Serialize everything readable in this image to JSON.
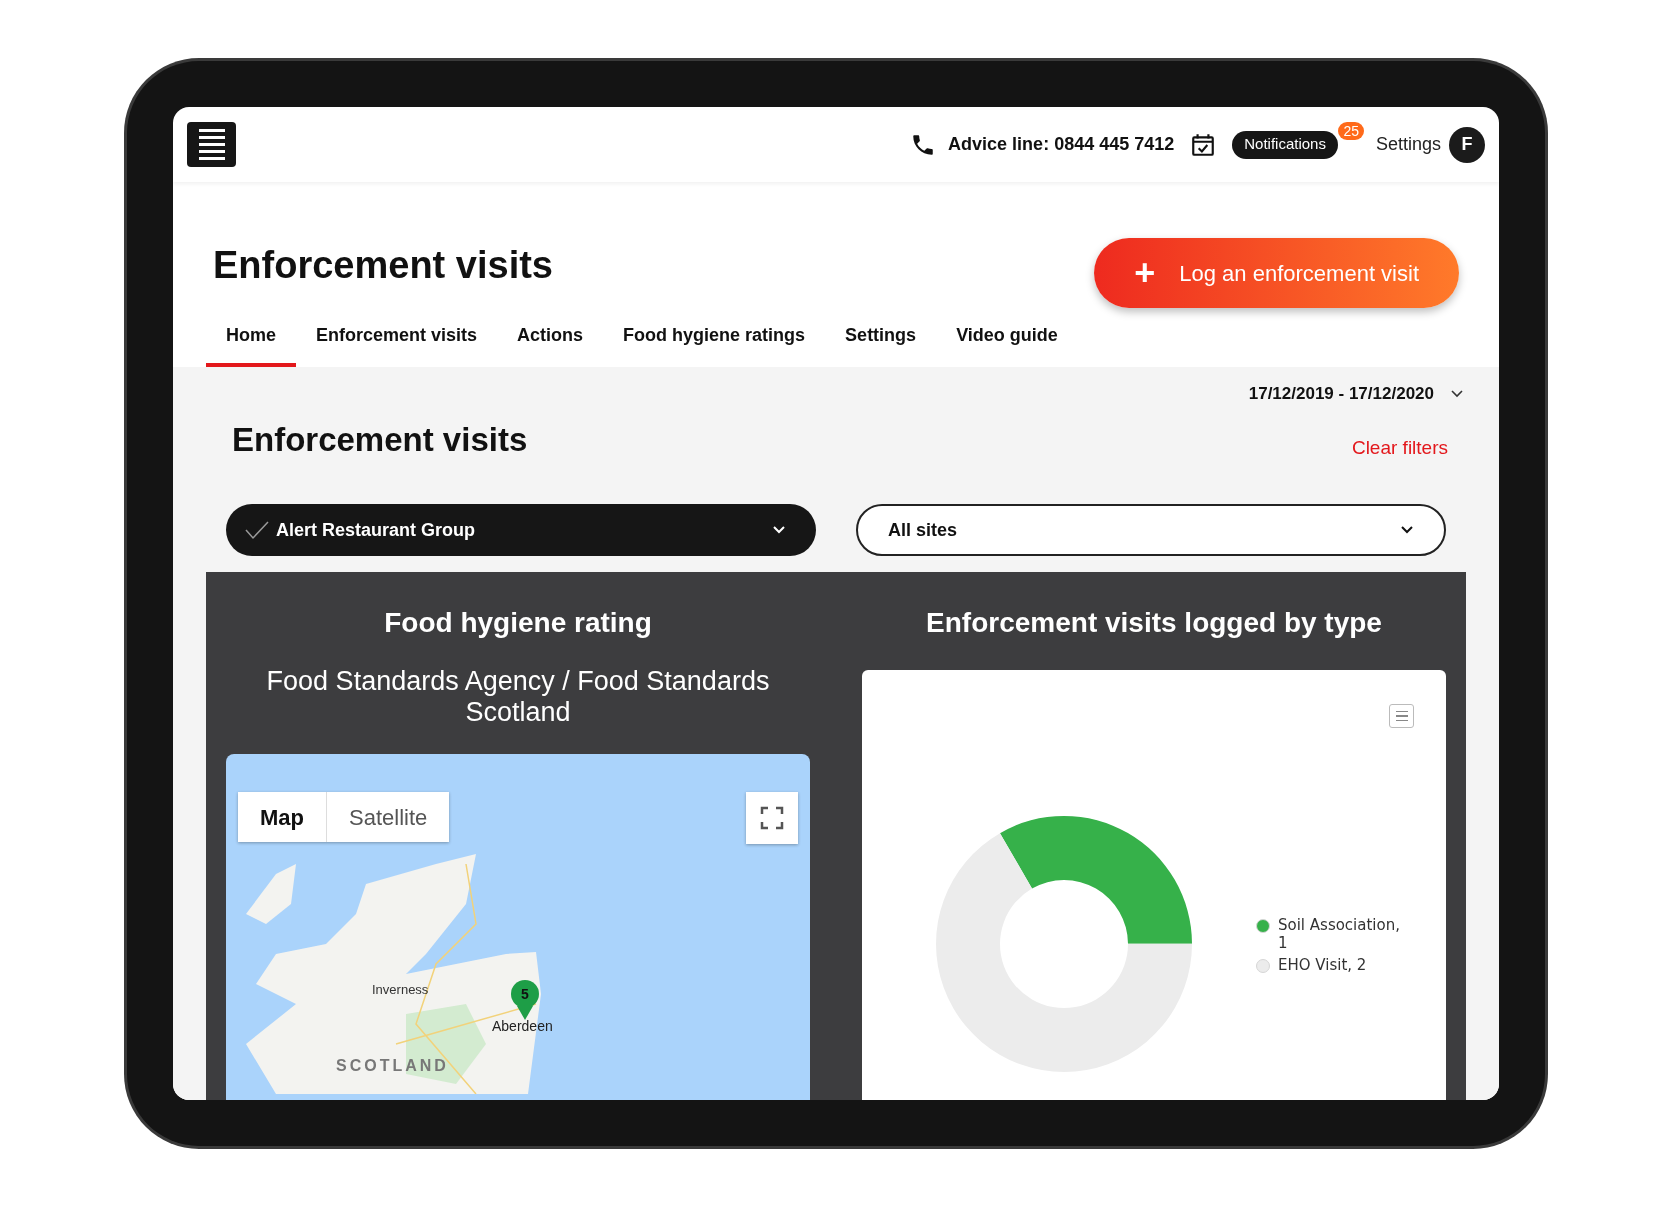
{
  "header": {
    "advice_line": "Advice line: 0844 445 7412",
    "notifications": {
      "label": "Notifications",
      "count": "25"
    },
    "settings": "Settings",
    "avatar": "F"
  },
  "page_title": "Enforcement visits",
  "primary_action": {
    "icon": "+",
    "label": "Log an enforcement visit"
  },
  "tabs": [
    {
      "label": "Home",
      "selected": true
    },
    {
      "label": "Enforcement visits",
      "selected": false
    },
    {
      "label": "Actions",
      "selected": false
    },
    {
      "label": "Food hygiene ratings",
      "selected": false
    },
    {
      "label": "Settings",
      "selected": false
    },
    {
      "label": "Video guide",
      "selected": false
    }
  ],
  "date_range": "17/12/2019 - 17/12/2020",
  "section_title": "Enforcement visits",
  "clear_filters": "Clear filters",
  "filters": [
    {
      "value": "Alert Restaurant Group",
      "kind": "dark"
    },
    {
      "value": "All sites",
      "kind": "light"
    }
  ],
  "hygiene_panel": {
    "title": "Food hygiene rating",
    "subtitle": "Food Standards Agency / Food Standards Scotland",
    "map": {
      "types": [
        {
          "label": "Map",
          "selected": true
        },
        {
          "label": "Satellite",
          "selected": false
        }
      ],
      "places": [
        "Inverness",
        "Aberdeen"
      ],
      "region": "SCOTLAND",
      "marker": "5"
    }
  },
  "visits_panel": {
    "title": "Enforcement visits logged by type",
    "legend": [
      {
        "label": "Soil Association, 1",
        "color": "#36b14a"
      },
      {
        "label": "EHO Visit, 2",
        "color": "#ececec"
      }
    ],
    "chart_data": {
      "type": "donut",
      "values": [
        33.3,
        66.7
      ]
    }
  }
}
